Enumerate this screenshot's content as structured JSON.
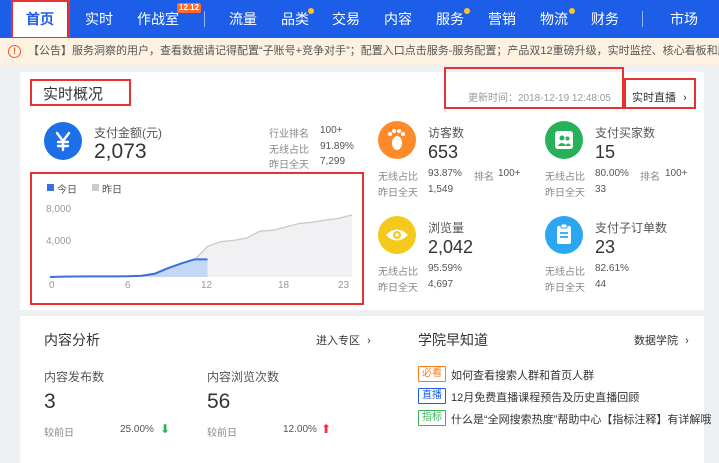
{
  "nav": {
    "items": [
      {
        "label": "首页"
      },
      {
        "label": "实时"
      },
      {
        "label": "作战室",
        "badge": "12.12"
      },
      {
        "label": "流量"
      },
      {
        "label": "品类"
      },
      {
        "label": "交易"
      },
      {
        "label": "内容"
      },
      {
        "label": "服务"
      },
      {
        "label": "营销"
      },
      {
        "label": "物流"
      },
      {
        "label": "财务"
      },
      {
        "label": "市场"
      }
    ]
  },
  "notice": {
    "icon": "exclamation-icon",
    "text": "【公告】服务洞察的用户，查看数据请记得配置“子账号+竞争对手”；配置入口点击服务-服务配置；产品双12重磅升级，实时监控、核心看板和服务明"
  },
  "realtime": {
    "title": "实时概况",
    "update_time": "更新时间：2018-12-19 12:48:05",
    "live_link": "实时直播",
    "payment": {
      "icon": "yen-icon",
      "label": "支付金额(元)",
      "value": "2,073",
      "rank_label": "行业排名",
      "rank_value": "100+",
      "wireless_label": "无线占比",
      "wireless_value": "91.89%",
      "yesterday_label": "昨日全天",
      "yesterday_value": "7,299"
    },
    "visitors": {
      "icon": "footprint-icon",
      "label": "访客数",
      "value": "653",
      "wireless_label": "无线占比",
      "wireless_value": "93.87%",
      "rank_label": "排名",
      "rank_value": "100+",
      "yesterday_label": "昨日全天",
      "yesterday_value": "1,549"
    },
    "buyers": {
      "icon": "users-icon",
      "label": "支付买家数",
      "value": "15",
      "wireless_label": "无线占比",
      "wireless_value": "80.00%",
      "rank_label": "排名",
      "rank_value": "100+",
      "yesterday_label": "昨日全天",
      "yesterday_value": "33"
    },
    "pageviews": {
      "icon": "eye-icon",
      "label": "浏览量",
      "value": "2,042",
      "wireless_label": "无线占比",
      "wireless_value": "95.59%",
      "yesterday_label": "昨日全天",
      "yesterday_value": "4,697"
    },
    "suborders": {
      "icon": "clipboard-icon",
      "label": "支付子订单数",
      "value": "23",
      "wireless_label": "无线占比",
      "wireless_value": "82.61%",
      "yesterday_label": "昨日全天",
      "yesterday_value": "44"
    },
    "colors": {
      "today": "#3b6fdc",
      "yesterday": "#cccccc",
      "orange": "#ff8a2a",
      "green": "#27b158",
      "yellow": "#f4c91c",
      "blue": "#2aa6f2"
    }
  },
  "chart_data": {
    "type": "area",
    "legend": [
      "今日",
      "昨日"
    ],
    "x_ticks": [
      "0",
      "6",
      "12",
      "18",
      "23"
    ],
    "y_ticks": [
      "8,000",
      "4,000"
    ],
    "ylim": [
      0,
      8000
    ],
    "xlim": [
      0,
      23
    ],
    "series": [
      {
        "name": "今日",
        "x": [
          0,
          1,
          2,
          3,
          4,
          5,
          6,
          7,
          8,
          9,
          10,
          11,
          12
        ],
        "values": [
          0,
          40,
          60,
          70,
          75,
          80,
          90,
          150,
          400,
          1050,
          1600,
          2073,
          2073
        ]
      },
      {
        "name": "昨日",
        "x": [
          0,
          1,
          2,
          3,
          4,
          5,
          6,
          7,
          8,
          9,
          10,
          11,
          12,
          13,
          14,
          15,
          16,
          17,
          18,
          19,
          20,
          21,
          22,
          23
        ],
        "values": [
          0,
          40,
          60,
          70,
          75,
          80,
          90,
          150,
          400,
          1050,
          1600,
          2000,
          3600,
          4150,
          4300,
          4600,
          5400,
          5500,
          5900,
          6300,
          6450,
          6700,
          6900,
          7299
        ]
      }
    ]
  },
  "content": {
    "title": "内容分析",
    "enter_link": "进入专区",
    "publish": {
      "label": "内容发布数",
      "value": "3",
      "compare_label": "较前日",
      "compare_value": "25.00%",
      "trend": "down-arrow-icon"
    },
    "views": {
      "label": "内容浏览次数",
      "value": "56",
      "compare_label": "较前日",
      "compare_value": "12.00%",
      "trend": "up-arrow-icon"
    }
  },
  "academy": {
    "title": "学院早知道",
    "link": "数据学院",
    "items": [
      {
        "tag": "必看",
        "tag_color": "#ff7a1a",
        "text": "如何查看搜索人群和首页人群"
      },
      {
        "tag": "直播",
        "tag_color": "#1d5ee8",
        "text": "12月免费直播课程预告及历史直播回顾"
      },
      {
        "tag": "指标",
        "tag_color": "#3db35a",
        "text": "什么是“全网搜索热度”帮助中心【指标注释】有详解哦"
      }
    ]
  }
}
